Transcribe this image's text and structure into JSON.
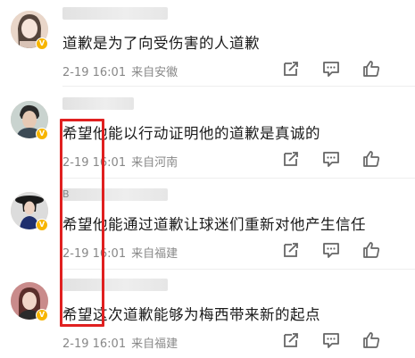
{
  "comments": [
    {
      "username": "",
      "initial": "",
      "text": "道歉是为了向受伤害的人道歉",
      "date": "2-19 16:01",
      "location": "来自安徽"
    },
    {
      "username": "",
      "initial": "",
      "text": "希望他能以行动证明他的道歉是真诚的",
      "date": "2-19 16:01",
      "location": "来自河南"
    },
    {
      "username": "",
      "initial": "B",
      "text": "希望他能通过道歉让球迷们重新对他产生信任",
      "date": "2-19 16:01",
      "location": "来自福建"
    },
    {
      "username": "",
      "initial": "",
      "text": "希望这次道歉能够为梅西带来新的起点",
      "date": "2-19 16:01",
      "location": "来自福建"
    }
  ],
  "badge_label": "V",
  "icons": {
    "share": "share-icon",
    "reply": "comment-icon",
    "like": "thumbs-up-icon"
  },
  "colors": {
    "highlight": "#e02020",
    "badge": "#f7b500",
    "meta": "#888888"
  }
}
